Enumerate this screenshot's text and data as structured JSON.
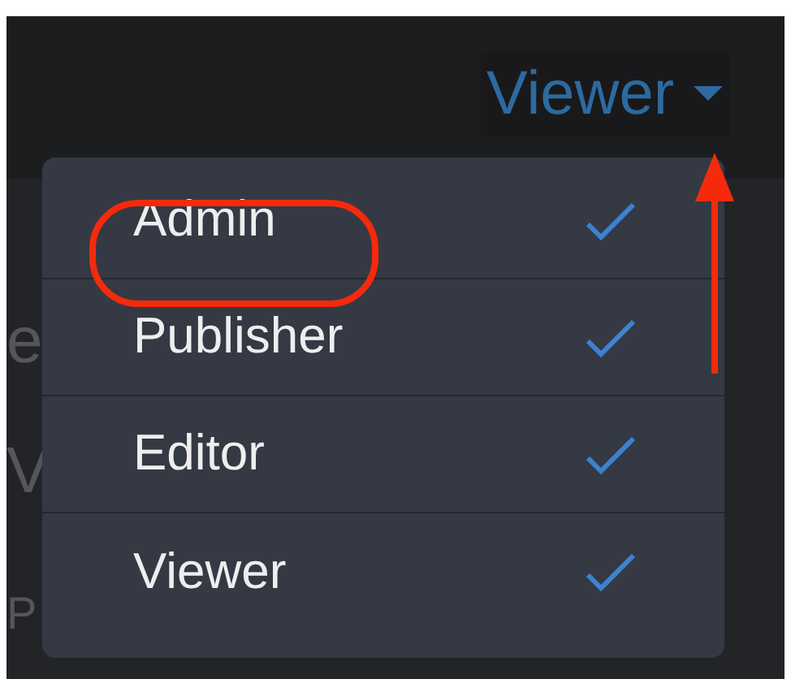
{
  "role_dropdown": {
    "label": "Viewer",
    "expanded": true
  },
  "background_fragments": [
    "e",
    "V",
    "P"
  ],
  "menu": {
    "items": [
      {
        "label": "Admin",
        "checked": true,
        "circled": true
      },
      {
        "label": "Publisher",
        "checked": true,
        "circled": false
      },
      {
        "label": "Editor",
        "checked": true,
        "circled": false
      },
      {
        "label": "Viewer",
        "checked": true,
        "circled": false
      }
    ]
  },
  "annotation_arrow": true
}
